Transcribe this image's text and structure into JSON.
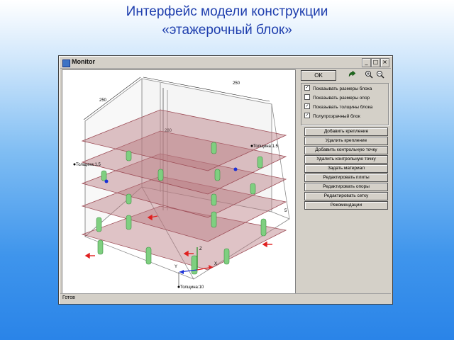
{
  "slide": {
    "title_line1": "Интерфейс  модели конструкции",
    "title_line2": "«этажерочный блок»"
  },
  "window": {
    "title": "Monitor",
    "controls": {
      "minimize": "_",
      "maximize": "□",
      "close": "×"
    },
    "status_text": "Готов"
  },
  "viewport": {
    "dim_labels": {
      "depth": "250",
      "width": "250",
      "height": "280",
      "side": "5"
    },
    "thickness_labels": {
      "left": "Толщина:1.5",
      "right": "Толщина:1.5",
      "bottom": "Толщина:10"
    },
    "axis_labels": {
      "x": "X",
      "y": "Y",
      "z": "Z"
    },
    "colors": {
      "slab_fill": "#b97b80",
      "slab_edge": "#9c4b55",
      "column": "#7fcf80",
      "column_edge": "#3f8f45",
      "box_edge": "#8a8a8a",
      "marker": "#1a2fd6",
      "arrow": "#e02020"
    }
  },
  "panel": {
    "ok_label": "OK",
    "tool_icons": [
      "rotate-icon",
      "zoom-in-icon",
      "zoom-out-icon"
    ],
    "options": [
      {
        "label": "Показывать размеры блока",
        "checked": true
      },
      {
        "label": "Показывать размеры опор",
        "checked": false
      },
      {
        "label": "Показывать толщины блока",
        "checked": true
      },
      {
        "label": "Полупрозрачный блок",
        "checked": true
      }
    ],
    "buttons": [
      "Добавить крепление",
      "Удалить крепление",
      "Добавить контрольную точку",
      "Удалить контрольную точку",
      "Задать материал",
      "Редактировать плиты",
      "Редактировать опоры",
      "Редактировать сетку",
      "Рекомендации"
    ]
  }
}
